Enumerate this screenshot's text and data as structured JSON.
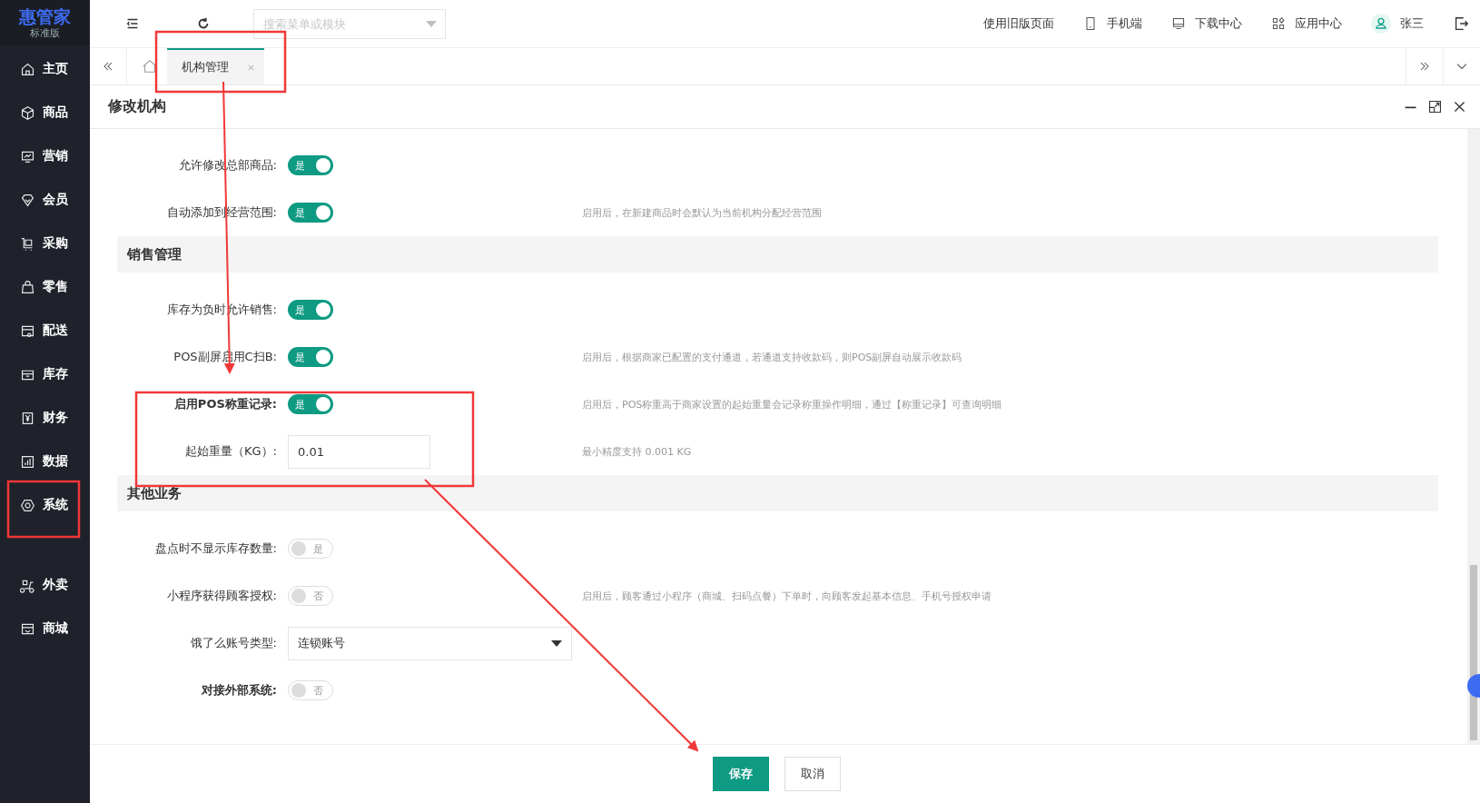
{
  "logo": {
    "title": "惠管家",
    "subtitle": "标准版"
  },
  "sidebar": {
    "items": [
      {
        "label": "主页"
      },
      {
        "label": "商品"
      },
      {
        "label": "营销"
      },
      {
        "label": "会员"
      },
      {
        "label": "采购"
      },
      {
        "label": "零售"
      },
      {
        "label": "配送"
      },
      {
        "label": "库存"
      },
      {
        "label": "财务"
      },
      {
        "label": "数据"
      },
      {
        "label": "系统"
      }
    ],
    "extra_items": [
      {
        "label": "外卖"
      },
      {
        "label": "商城"
      }
    ]
  },
  "topbar": {
    "search": {
      "placeholder": "搜索菜单或模块"
    },
    "old_version_link": "使用旧版页面",
    "links": [
      {
        "label": "手机端"
      },
      {
        "label": "下载中心"
      },
      {
        "label": "应用中心"
      }
    ],
    "user": "张三"
  },
  "tabs": [
    {
      "label": "机构管理",
      "selected": true
    }
  ],
  "dialog": {
    "title": "修改机构",
    "rows": [
      {
        "kind": "toggle",
        "label": "允许修改总部商品:",
        "bold": false,
        "on": true,
        "toggle_text": "是"
      },
      {
        "kind": "toggle",
        "label": "自动添加到经营范围:",
        "bold": false,
        "on": true,
        "toggle_text": "是",
        "hint": "启用后，在新建商品时会默认为当前机构分配经营范围"
      },
      {
        "kind": "section",
        "label": "销售管理"
      },
      {
        "kind": "toggle",
        "label": "库存为负时允许销售:",
        "bold": false,
        "on": true,
        "toggle_text": "是"
      },
      {
        "kind": "toggle",
        "label": "POS副屏启用C扫B:",
        "bold": false,
        "on": true,
        "toggle_text": "是",
        "hint": "启用后，根据商家已配置的支付通道，若通道支持收款码，则POS副屏自动展示收款码"
      },
      {
        "kind": "toggle",
        "label": "启用POS称重记录:",
        "bold": true,
        "on": true,
        "toggle_text": "是",
        "hint": "启用后，POS称重高于商家设置的起始重量会记录称重操作明细，通过【称重记录】可查询明细"
      },
      {
        "kind": "input",
        "label": "起始重量（KG）:",
        "bold": false,
        "value": "0.01",
        "hint": "最小精度支持 0.001 KG"
      },
      {
        "kind": "section",
        "label": "其他业务"
      },
      {
        "kind": "toggle",
        "label": "盘点时不显示库存数量:",
        "bold": false,
        "on": false,
        "toggle_text": "是"
      },
      {
        "kind": "toggle",
        "label": "小程序获得顾客授权:",
        "bold": false,
        "on": false,
        "toggle_text": "否",
        "hint": "启用后，顾客通过小程序（商城、扫码点餐）下单时，向顾客发起基本信息、手机号授权申请"
      },
      {
        "kind": "select",
        "label": "饿了么账号类型:",
        "bold": false,
        "value": "连锁账号"
      },
      {
        "kind": "toggle",
        "label": "对接外部系统:",
        "bold": true,
        "on": false,
        "toggle_text": "否"
      }
    ],
    "buttons": [
      {
        "label": "保存",
        "kind": "primary"
      },
      {
        "label": "取消",
        "kind": "default"
      }
    ]
  }
}
